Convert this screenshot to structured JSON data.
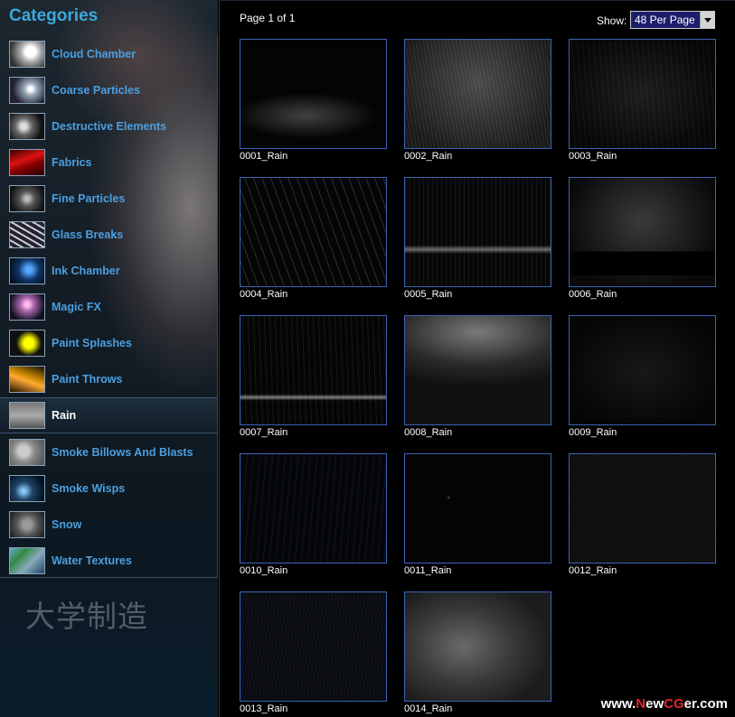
{
  "sidebar": {
    "title": "Categories",
    "active_index": 10,
    "items": [
      {
        "label": "Cloud Chamber",
        "thumb": "cloud"
      },
      {
        "label": "Coarse Particles",
        "thumb": "burst"
      },
      {
        "label": "Destructive Elements",
        "thumb": "debris"
      },
      {
        "label": "Fabrics",
        "thumb": "fabric"
      },
      {
        "label": "Fine Particles",
        "thumb": "fine"
      },
      {
        "label": "Glass Breaks",
        "thumb": "glass"
      },
      {
        "label": "Ink Chamber",
        "thumb": "ink"
      },
      {
        "label": "Magic FX",
        "thumb": "magic"
      },
      {
        "label": "Paint Splashes",
        "thumb": "paint"
      },
      {
        "label": "Paint Throws",
        "thumb": "throw"
      },
      {
        "label": "Rain",
        "thumb": "rain"
      },
      {
        "label": "Smoke Billows And Blasts",
        "thumb": "smoke"
      },
      {
        "label": "Smoke Wisps",
        "thumb": "wisp"
      },
      {
        "label": "Snow",
        "thumb": "snow"
      },
      {
        "label": "Water Textures",
        "thumb": "water"
      }
    ],
    "watermark": "大学制造"
  },
  "main": {
    "page_info": "Page 1 of 1",
    "show_label": "Show:",
    "per_page": {
      "selected": "48 Per Page"
    },
    "thumbnails": [
      {
        "caption": "0001_Rain",
        "style": "sparse-bottom"
      },
      {
        "caption": "0002_Rain",
        "style": "dense-grey"
      },
      {
        "caption": "0003_Rain",
        "style": "dark-drops"
      },
      {
        "caption": "0004_Rain",
        "style": "streaks"
      },
      {
        "caption": "0005_Rain",
        "style": "horizon"
      },
      {
        "caption": "0006_Rain",
        "style": "box"
      },
      {
        "caption": "0007_Rain",
        "style": "horizon-low"
      },
      {
        "caption": "0008_Rain",
        "style": "light-top"
      },
      {
        "caption": "0009_Rain",
        "style": "dark-sparse"
      },
      {
        "caption": "0010_Rain",
        "style": "blue-drops"
      },
      {
        "caption": "0011_Rain",
        "style": "dark-dots"
      },
      {
        "caption": "0012_Rain",
        "style": "fine-noise"
      },
      {
        "caption": "0013_Rain",
        "style": "blue-noise"
      },
      {
        "caption": "0014_Rain",
        "style": "fog"
      }
    ]
  },
  "footer": {
    "site_prefix": "www.",
    "site_brand_red_1": "N",
    "site_mid": "ew",
    "site_brand_red_2": "CG",
    "site_suffix": "er.com"
  },
  "colors": {
    "accent_blue": "#3aa9dc",
    "link_blue": "#4b9fe0",
    "thumb_border": "#3c63b6",
    "brand_red": "#e3242b"
  }
}
